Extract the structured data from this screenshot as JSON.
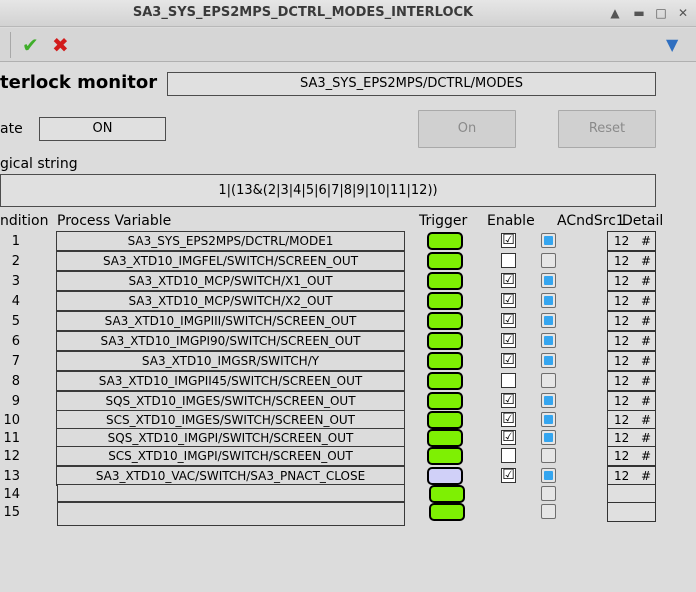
{
  "window": {
    "title": "SA3_SYS_EPS2MPS_DCTRL_MODES_INTERLOCK"
  },
  "header": {
    "title": "terlock monitor",
    "device": "SA3_SYS_EPS2MPS/DCTRL/MODES",
    "state_label": "ate",
    "state_value": "ON",
    "on_button": "On",
    "reset_button": "Reset",
    "logical_label": "gical string",
    "logical_value": "1|(13&(2|3|4|5|6|7|8|9|10|11|12))"
  },
  "columns": {
    "condition": "ndition",
    "pv": "Process Variable",
    "trigger": "Trigger",
    "enable": "Enable",
    "acnd": "ACndSrc1",
    "detail": "Detail"
  },
  "colors": {
    "led_on": "#7ef003",
    "led_off": "#d0d0f8",
    "acnd_on": "#34a5ef"
  },
  "rows": [
    {
      "n": "1",
      "pv": "SA3_SYS_EPS2MPS/DCTRL/MODE1",
      "trigger": true,
      "enable": true,
      "acnd": true,
      "src": "12",
      "detail": "#"
    },
    {
      "n": "2",
      "pv": "SA3_XTD10_IMGFEL/SWITCH/SCREEN_OUT",
      "trigger": true,
      "enable": false,
      "acnd": false,
      "src": "12",
      "detail": "#"
    },
    {
      "n": "3",
      "pv": "SA3_XTD10_MCP/SWITCH/X1_OUT",
      "trigger": true,
      "enable": true,
      "acnd": true,
      "src": "12",
      "detail": "#"
    },
    {
      "n": "4",
      "pv": "SA3_XTD10_MCP/SWITCH/X2_OUT",
      "trigger": true,
      "enable": true,
      "acnd": true,
      "src": "12",
      "detail": "#"
    },
    {
      "n": "5",
      "pv": "SA3_XTD10_IMGPIII/SWITCH/SCREEN_OUT",
      "trigger": true,
      "enable": true,
      "acnd": true,
      "src": "12",
      "detail": "#"
    },
    {
      "n": "6",
      "pv": "SA3_XTD10_IMGPI90/SWITCH/SCREEN_OUT",
      "trigger": true,
      "enable": true,
      "acnd": true,
      "src": "12",
      "detail": "#"
    },
    {
      "n": "7",
      "pv": "SA3_XTD10_IMGSR/SWITCH/Y",
      "trigger": true,
      "enable": true,
      "acnd": true,
      "src": "12",
      "detail": "#"
    },
    {
      "n": "8",
      "pv": "SA3_XTD10_IMGPII45/SWITCH/SCREEN_OUT",
      "trigger": true,
      "enable": false,
      "acnd": false,
      "src": "12",
      "detail": "#"
    },
    {
      "n": "9",
      "pv": "SQS_XTD10_IMGES/SWITCH/SCREEN_OUT",
      "trigger": true,
      "enable": true,
      "acnd": true,
      "src": "12",
      "detail": "#"
    },
    {
      "n": "10",
      "pv": "SCS_XTD10_IMGES/SWITCH/SCREEN_OUT",
      "trigger": true,
      "enable": true,
      "acnd": true,
      "src": "12",
      "detail": "#"
    },
    {
      "n": "11",
      "pv": "SQS_XTD10_IMGPI/SWITCH/SCREEN_OUT",
      "trigger": true,
      "enable": true,
      "acnd": true,
      "src": "12",
      "detail": "#"
    },
    {
      "n": "12",
      "pv": "SCS_XTD10_IMGPI/SWITCH/SCREEN_OUT",
      "trigger": true,
      "enable": false,
      "acnd": false,
      "src": "12",
      "detail": "#"
    },
    {
      "n": "13",
      "pv": "SA3_XTD10_VAC/SWITCH/SA3_PNACT_CLOSE",
      "trigger": false,
      "enable": true,
      "acnd": true,
      "src": "12",
      "detail": "#"
    },
    {
      "n": "14",
      "pv": "",
      "trigger": true,
      "enable": null,
      "acnd": false,
      "src": "",
      "detail": ""
    },
    {
      "n": "15",
      "pv": "",
      "trigger": true,
      "enable": null,
      "acnd": false,
      "src": "",
      "detail": ""
    }
  ]
}
